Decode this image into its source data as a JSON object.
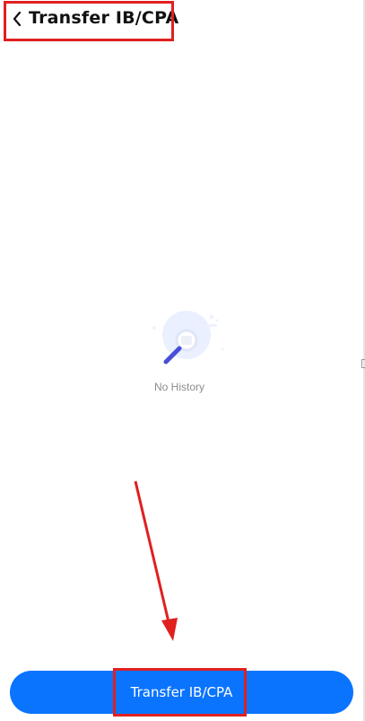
{
  "header": {
    "back_icon": "chevron-left-icon",
    "title": "Transfer IB/CPA"
  },
  "empty_state": {
    "illustration_icon": "magnifier-search-icon",
    "text": "No History"
  },
  "footer": {
    "button_label": "Transfer IB/CPA"
  },
  "colors": {
    "primary": "#0a74ff",
    "annotation": "#e02020",
    "empty_text": "#8c8c8c"
  }
}
